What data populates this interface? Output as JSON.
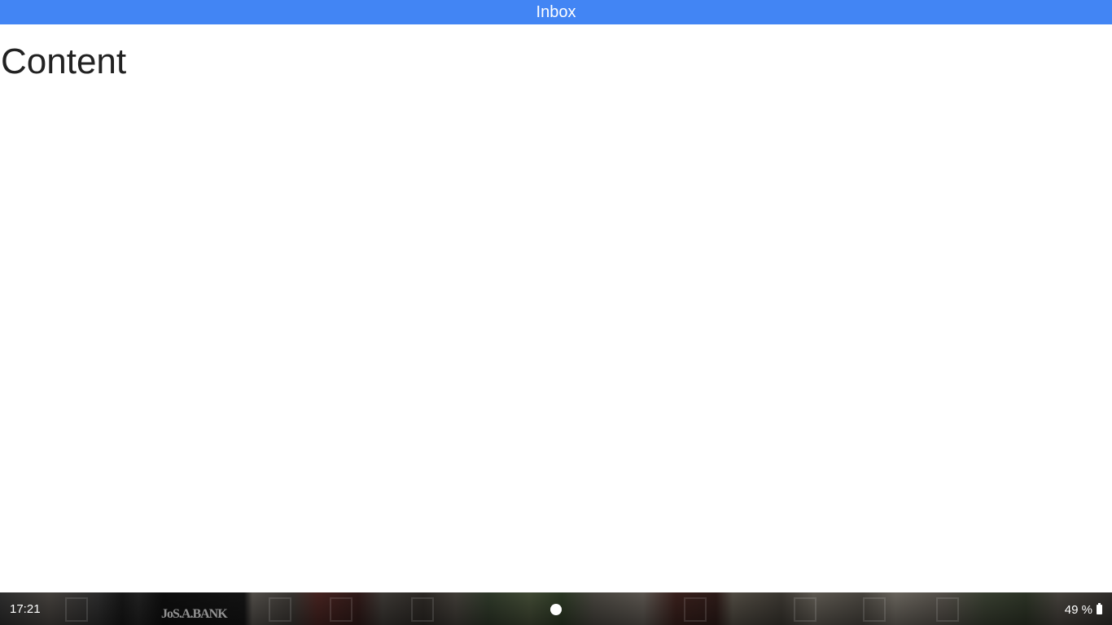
{
  "window": {
    "title": "Inbox",
    "accent_color": "#4285f4"
  },
  "main": {
    "heading": "Content"
  },
  "shelf": {
    "time": "17:21",
    "battery_percent_label": "49 %",
    "battery_icon": "battery-icon",
    "launcher_icon": "launcher-circle-icon"
  }
}
